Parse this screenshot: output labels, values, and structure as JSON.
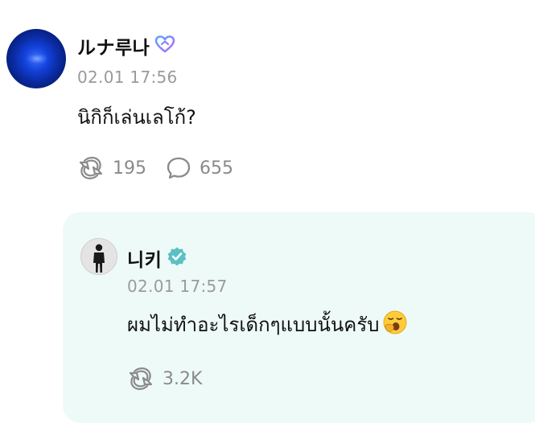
{
  "post": {
    "author": "ルナ루나",
    "timestamp": "02.01 17:56",
    "text": "นิกิก็เล่นเลโก้?",
    "repost_count": "195",
    "comment_count": "655",
    "badge_color": "#8b6cff"
  },
  "reply": {
    "author": "니키",
    "timestamp": "02.01 17:57",
    "text": "ผมไม่ทำอะไรเด็กๆแบบนั้นครับ",
    "repost_count": "3.2K",
    "verified_color": "#5bc0c4",
    "card_background": "#eefaf8"
  },
  "icons": {
    "post_badge": "heart-outline-icon",
    "reply_badge": "verified-check-icon",
    "repost": "repost-icon",
    "comment": "comment-bubble-icon",
    "emoji": "yawning-face-emoji"
  }
}
